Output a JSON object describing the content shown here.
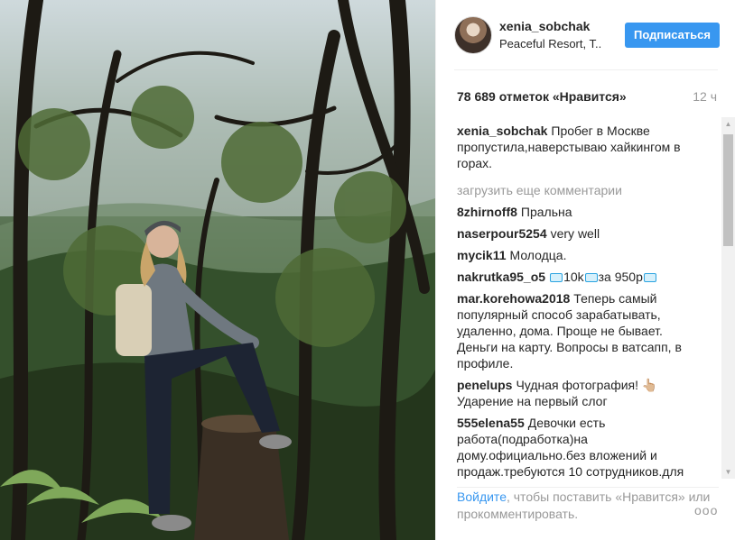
{
  "header": {
    "username": "xenia_sobchak",
    "location": "Peaceful Resort, T..",
    "follow_label": "Подписаться"
  },
  "stats": {
    "likes": "78 689 отметок «Нравится»",
    "time": "12 ч"
  },
  "caption": {
    "user": "xenia_sobchak",
    "text": "Пробег в Москве пропустила,наверстываю хайкингом в горах."
  },
  "load_more": "загрузить еще комментарии",
  "comments": [
    {
      "user": "8zhirnoff8",
      "text": "Пральна"
    },
    {
      "user": "naserpour5254",
      "text": "very well"
    },
    {
      "user": "mycik11",
      "text": "Молодца."
    },
    {
      "user": "nakrutka95_o5",
      "parts": [
        "10k",
        "за 950р"
      ]
    },
    {
      "user": "mar.korehowa2018",
      "text": "Теперь самый популярный способ зарабатывать, удаленно, дома. Проще не бывает. Деньги на карту. Вопросы в ватсапп, в профиле."
    },
    {
      "user": "penelups",
      "text": "Чудная фотография! 👆🏼 Ударение на первый слог"
    },
    {
      "user": "555elena55",
      "text": "Девочки есть работа(подработка)на дому.официально.без вложений и продаж.требуются 10 сотрудников.для"
    }
  ],
  "footer": {
    "login_link": "Войдите",
    "prompt": ", чтобы поставить «Нравится» или прокомментировать."
  },
  "more_label": "ооо",
  "colors": {
    "accent": "#3897f0",
    "muted": "#999999",
    "text": "#262626"
  }
}
